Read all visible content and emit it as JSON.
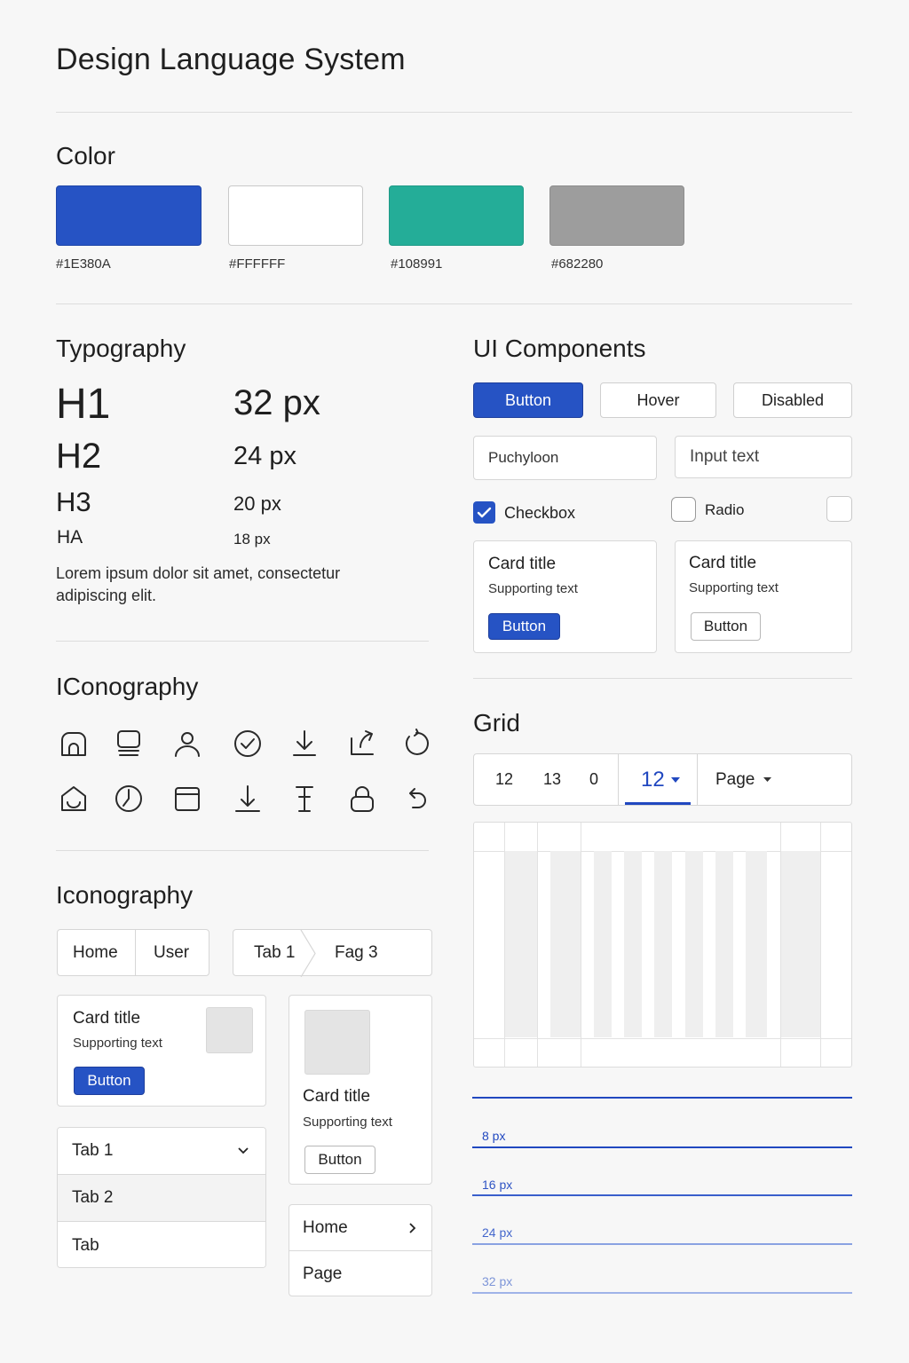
{
  "page": {
    "title": "Design Language System"
  },
  "color": {
    "heading": "Color",
    "swatches": [
      {
        "hex": "#1E380A",
        "fill": "#2653c4"
      },
      {
        "hex": "#FFFFFF",
        "fill": "#ffffff"
      },
      {
        "hex": "#108991",
        "fill": "#24ad98"
      },
      {
        "hex": "#682280",
        "fill": "#9d9d9d"
      }
    ]
  },
  "typography": {
    "heading": "Typography",
    "rows": [
      {
        "label": "H1",
        "size": "32 px"
      },
      {
        "label": "H2",
        "size": "24 px"
      },
      {
        "label": "H3",
        "size": "20 px"
      },
      {
        "label": "HA",
        "size": "18 px"
      }
    ],
    "body": "Lorem ipsum dolor sit amet, consectetur adipiscing elit."
  },
  "ui": {
    "heading": "UI Components",
    "buttons": {
      "primary": "Button",
      "hover": "Hover",
      "disabled": "Disabled"
    },
    "inputs": {
      "first_value": "Puchyloon",
      "second_placeholder": "Input text"
    },
    "checkbox": {
      "label": "Checkbox",
      "checked": true
    },
    "radio": {
      "label": "Radio"
    },
    "cards": [
      {
        "title": "Card title",
        "sub": "Supporting text",
        "button": "Button"
      },
      {
        "title": "Card title",
        "sub": "Supporting text",
        "button": "Button"
      }
    ]
  },
  "iconography": {
    "heading": "IConography",
    "icons_row1": [
      "home-icon",
      "monitor-icon",
      "user-icon",
      "check-circle-icon",
      "download-icon",
      "share-icon",
      "refresh-icon"
    ],
    "icons_row2": [
      "house-icon",
      "clock-icon",
      "folder-icon",
      "upload-icon",
      "text-cursor-icon",
      "lock-icon",
      "undo-icon"
    ]
  },
  "iconography2": {
    "heading": "Iconography",
    "seg1": [
      "Home",
      "User"
    ],
    "seg2": [
      "Tab 1",
      "Fag 3"
    ],
    "card_left": {
      "title": "Card title",
      "sub": "Supporting text",
      "button": "Button"
    },
    "card_right": {
      "title": "Card title",
      "sub": "Supporting text",
      "button": "Button"
    },
    "accordion": [
      "Tab 1",
      "Tab 2",
      "Tab"
    ],
    "nav_list": [
      "Home",
      "Page"
    ]
  },
  "grid": {
    "heading": "Grid",
    "tabs": [
      "12",
      "13",
      "0"
    ],
    "active": "12",
    "page_label": "Page",
    "spacing": [
      "8 px",
      "16 px",
      "24 px",
      "32 px"
    ],
    "accent": "#2148c0"
  }
}
